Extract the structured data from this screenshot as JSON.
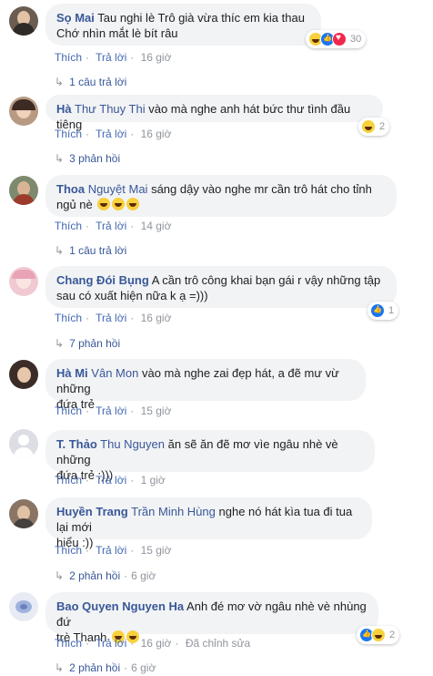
{
  "colors": {
    "name": "#385898",
    "bubble": "#f2f3f5",
    "meta": "#90949c",
    "link": "#4267b2"
  },
  "actions": {
    "like": "Thích",
    "reply": "Trả lời"
  },
  "comments": [
    {
      "author": "Sọ Mai",
      "tag": "",
      "text1": "Tau nghi lè Trô già vừa thíc em kia thau",
      "text2": "Chớ nhìn mắt lè bít râu",
      "time": "16 giờ",
      "replies": "1 câu trả lời",
      "reactions": "30",
      "reaction_icons": [
        "haha-icon",
        "like-icon",
        "love-icon"
      ]
    },
    {
      "author": "Hà",
      "tag": "Thư Thuy Thi",
      "text1": "vào mà nghe anh hát bức thư tình đầu tiêng",
      "text2": "",
      "time": "16 giờ",
      "replies": "3 phản hồi",
      "reactions": "2",
      "reaction_icons": [
        "haha-icon"
      ]
    },
    {
      "author": "Thoa",
      "tag": "Nguyệt Mai",
      "text1": "sáng dậy vào nghe mr cần trô hát cho tỉnh",
      "text2": "ngủ nè",
      "time": "14 giờ",
      "replies": "1 câu trả lời",
      "reactions": "",
      "reaction_icons": []
    },
    {
      "author": "Chang Đói Bụng",
      "tag": "",
      "text1": "A cần trô công khai bạn gái r vậy những tập",
      "text2": "sau có xuất hiện nữa k ạ =)))",
      "time": "16 giờ",
      "replies": "7 phản hồi",
      "reactions": "1",
      "reaction_icons": [
        "like-icon"
      ]
    },
    {
      "author": "Hà Mi",
      "tag": "Vân Mon",
      "text1": "vào mà nghe zai đẹp hát, a đẽ mư vừ những",
      "text2": "đứa trẻ",
      "time": "15 giờ",
      "replies": "",
      "reactions": "",
      "reaction_icons": []
    },
    {
      "author": "T. Thảo",
      "tag": "Thu Nguyen",
      "text1": "ăn sẽ ăn đẽ mơ vìe ngâu nhè vè những",
      "text2": "đứa trẻ :)))",
      "time": "1 giờ",
      "replies": "",
      "reactions": "",
      "reaction_icons": []
    },
    {
      "author": "Huyền Trang",
      "tag": "Trần Minh Hùng",
      "text1": "nghe nó hát kìa tua đi tua lại mới",
      "text2": "hiểu :))",
      "time": "15 giờ",
      "replies": "2 phản hồi",
      "replies_time": "6 giờ",
      "reactions": "",
      "reaction_icons": []
    },
    {
      "author": "Bao Quyen Nguyen Ha",
      "tag": "",
      "text1": "Anh đé mơ vờ ngâu nhè vè nhùng đứ",
      "text2": "trè Thanh",
      "time": "16 giờ",
      "edited": "Đã chỉnh sửa",
      "replies": "2 phản hồi",
      "replies_time": "6 giờ",
      "reactions": "2",
      "reaction_icons": [
        "like-icon",
        "haha-icon"
      ]
    }
  ]
}
